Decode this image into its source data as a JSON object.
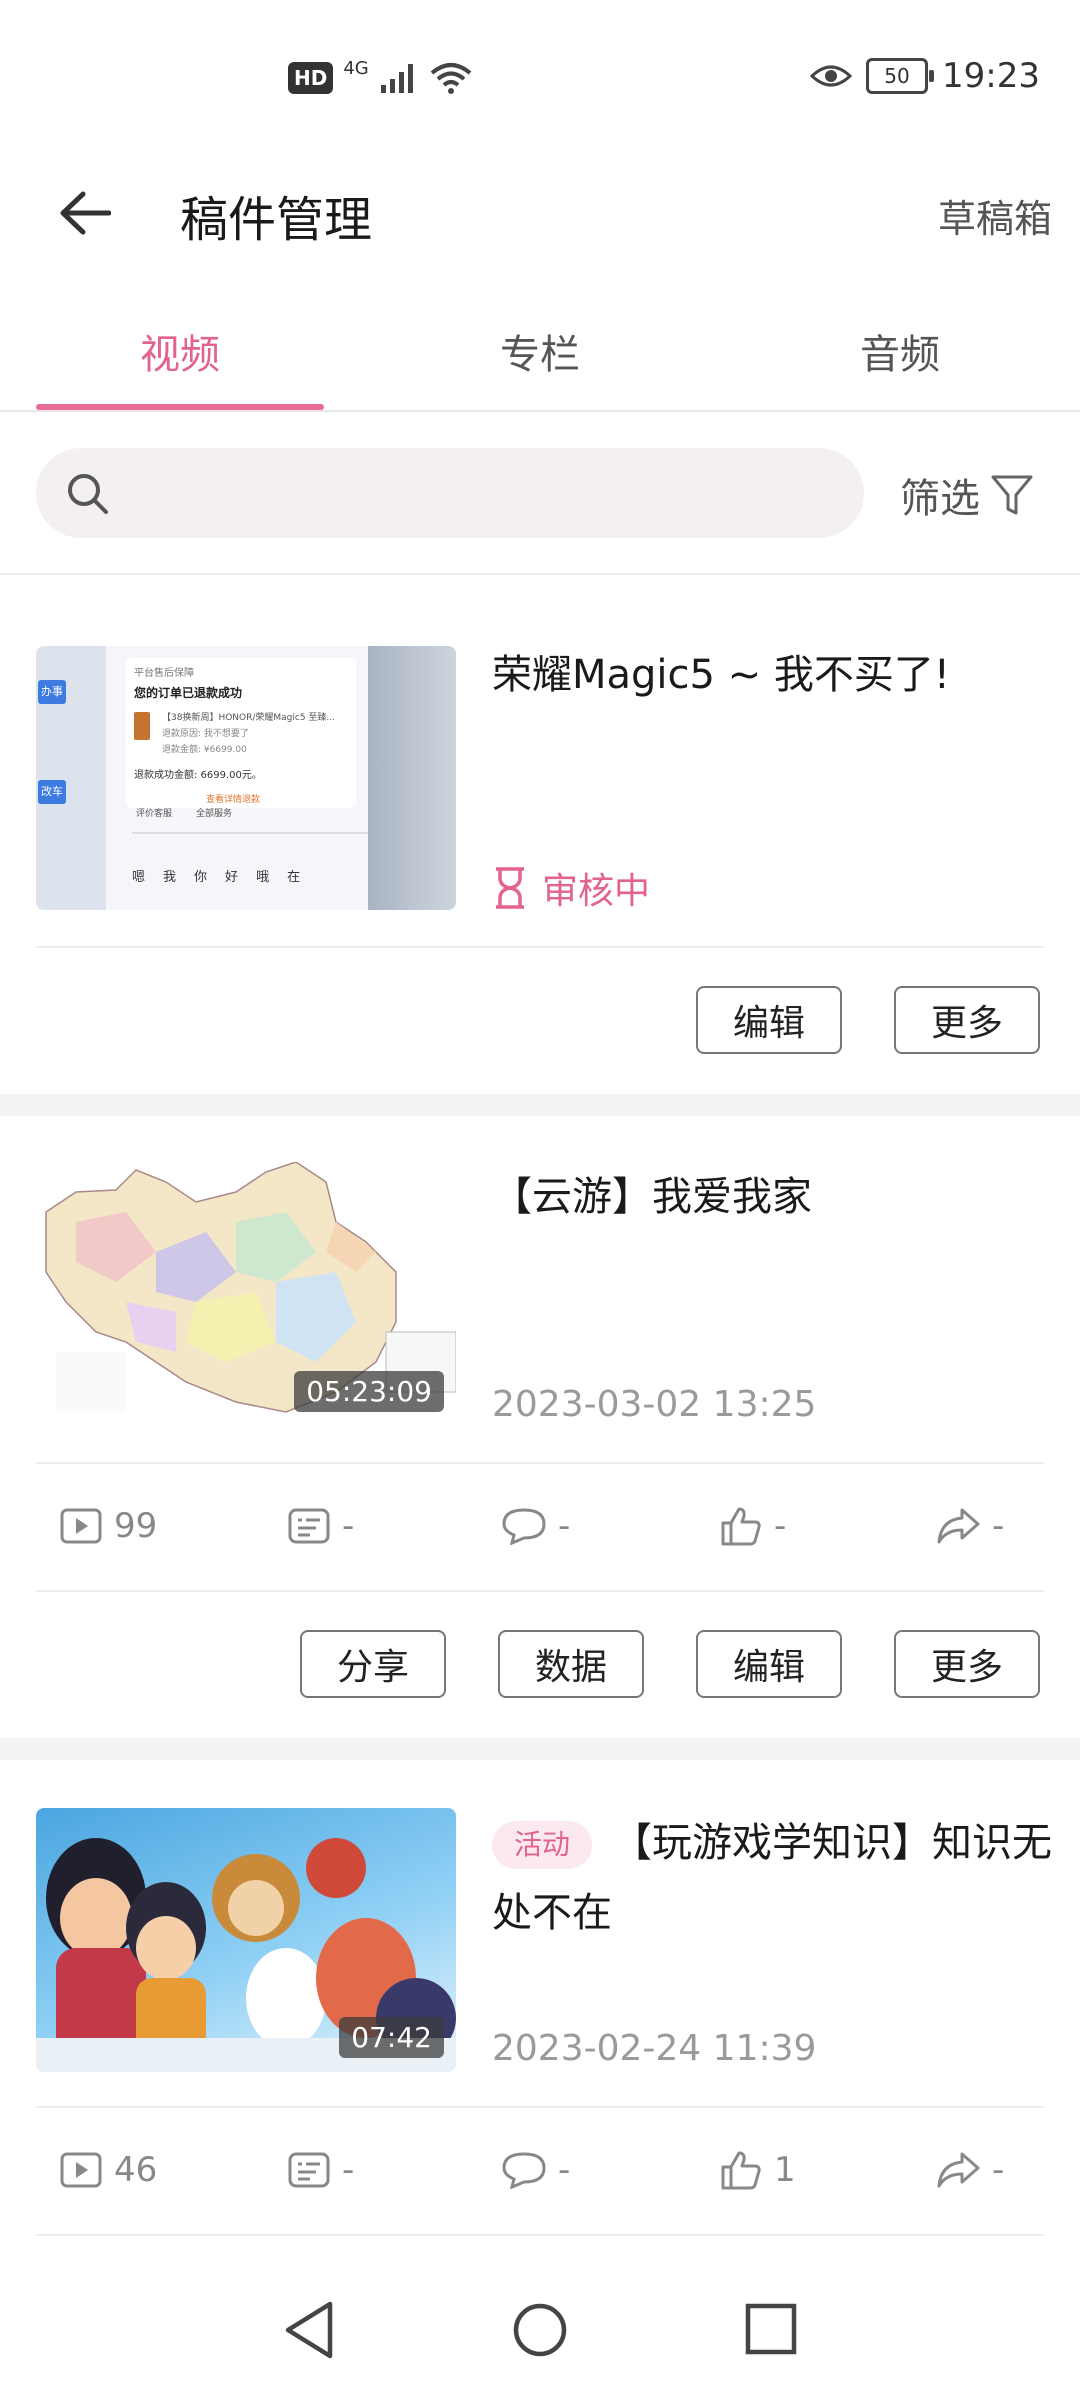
{
  "status_bar": {
    "hd": "HD",
    "network": "4G",
    "battery": "50",
    "time": "19:23"
  },
  "header": {
    "title": "稿件管理",
    "drafts": "草稿箱"
  },
  "tabs": [
    {
      "label": "视频",
      "active": true
    },
    {
      "label": "专栏",
      "active": false
    },
    {
      "label": "音频",
      "active": false
    }
  ],
  "search": {
    "placeholder": "",
    "filter_label": "筛选"
  },
  "accent_color": "#e2638f",
  "items": [
    {
      "title": "荣耀Magic5 ~ 我不买了!",
      "status": "审核中",
      "buttons": [
        "编辑",
        "更多"
      ],
      "thumb_text": {
        "header": "平台售后保障",
        "refund_title": "您的订单已退款成功",
        "product": "【38换新周】HONOR/荣耀Magic5 至臻...",
        "line1": "退款原因: 我不想要了",
        "line2": "退款金额: ¥6699.00",
        "amount": "退款成功金额: 6699.00元。",
        "link": "查看详情退款",
        "btn1": "评价客服",
        "btn2": "全部服务",
        "keys": [
          "嗯",
          "我",
          "你",
          "好",
          "哦",
          "在"
        ],
        "side1": "办事",
        "side2": "改车"
      }
    },
    {
      "title": "【云游】我爱我家",
      "duration": "05:23:09",
      "date": "2023-03-02 13:25",
      "stats": {
        "plays": "99",
        "danmaku": "-",
        "comments": "-",
        "likes": "-",
        "shares": "-"
      },
      "buttons": [
        "分享",
        "数据",
        "编辑",
        "更多"
      ]
    },
    {
      "tag": "活动",
      "title": "【玩游戏学知识】知识无处不在",
      "duration": "07:42",
      "date": "2023-02-24 11:39",
      "stats": {
        "plays": "46",
        "danmaku": "-",
        "comments": "-",
        "likes": "1",
        "shares": "-"
      }
    }
  ]
}
